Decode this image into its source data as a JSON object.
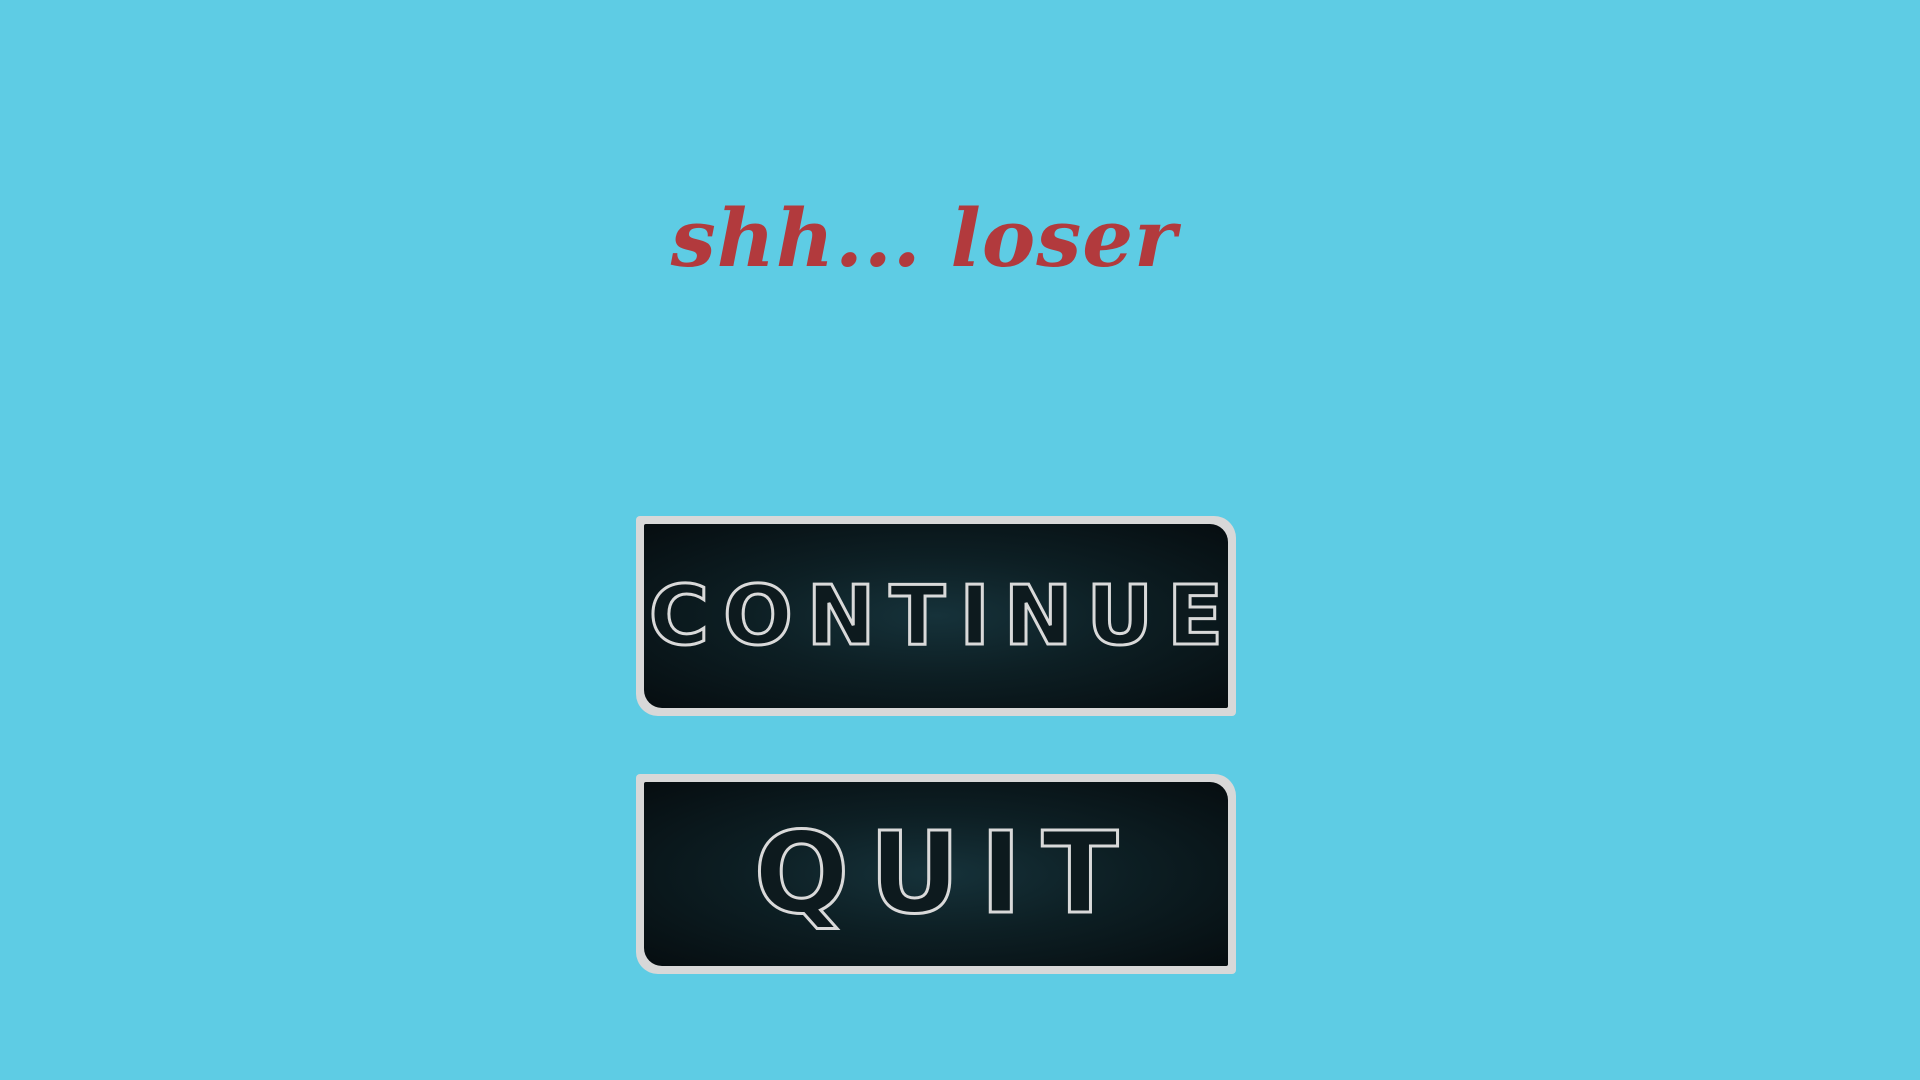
{
  "screen": {
    "title": "shh... loser",
    "background_color": "#5ecce4",
    "title_color": "#b23a3d"
  },
  "menu": {
    "continue_label": "CONTINUE",
    "quit_label": "QUIT"
  }
}
